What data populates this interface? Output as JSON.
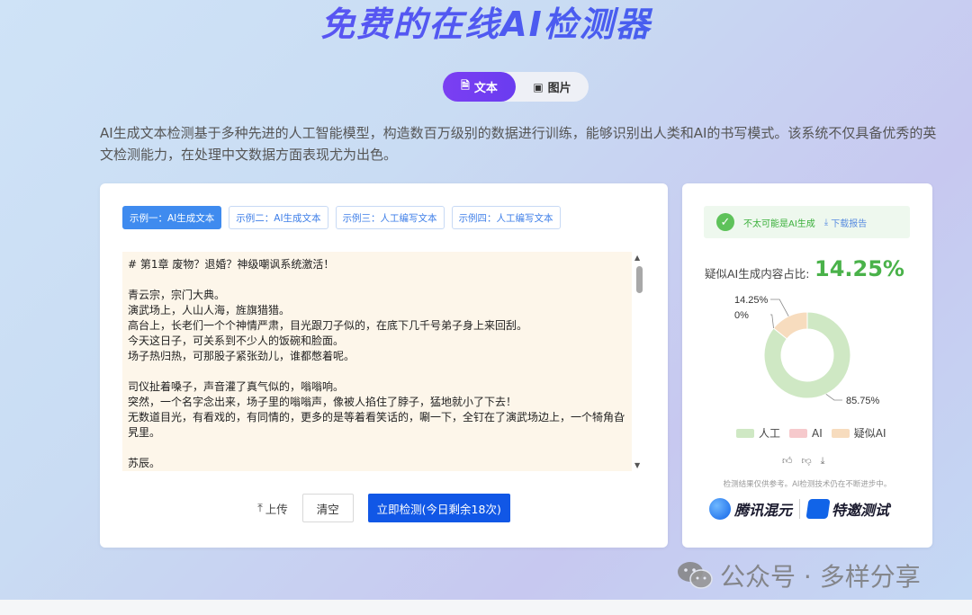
{
  "header": {
    "title": "免费的在线AI检测器"
  },
  "tabs": [
    {
      "label": "文本",
      "icon": "document-icon"
    },
    {
      "label": "图片",
      "icon": "image-icon"
    }
  ],
  "description": "AI生成文本检测基于多种先进的人工智能模型，构造数百万级别的数据进行训练，能够识别出人类和AI的书写模式。该系统不仅具备优秀的英文检测能力，在处理中文数据方面表现尤为出色。",
  "samples": [
    "示例一：AI生成文本",
    "示例二：AI生成文本",
    "示例三：人工编写文本",
    "示例四：人工编写文本"
  ],
  "editor": {
    "content": "# 第1章 废物？退婚？神级嘲讽系统激活！\n\n青云宗，宗门大典。\n演武场上，人山人海，旌旗猎猎。\n高台上，长老们一个个神情严肃，目光跟刀子似的，在底下几千号弟子身上来回刮。\n今天这日子，可关系到不少人的饭碗和脸面。\n场子热归热，可那股子紧张劲儿，谁都憋着呢。\n\n司仪扯着嗓子，声音灌了真气似的，嗡嗡响。\n突然，一个名字念出来，场子里的嗡嗡声，像被人掐住了脖子，猛地就小了下去！\n无数道目光，有看戏的，有同情的，更多的是等着看笑话的，唰一下，全钉在了演武场边上，一个犄角旮旯里。\n\n苏辰。\n就是他。"
  },
  "actions": {
    "upload_label": "上传",
    "clear_label": "清空",
    "detect_label": "立即检测(今日剩余18次)"
  },
  "result": {
    "status_text": "不太可能是AI生成",
    "download_label": "下载报告",
    "ratio_label": "疑似AI生成内容占比:",
    "ratio_value": "14.25%",
    "disclaimer": "检测结果仅供参考。AI检测技术仍在不断进步中。"
  },
  "chart_data": {
    "type": "pie",
    "categories": [
      "人工",
      "AI",
      "疑似AI"
    ],
    "values": [
      85.75,
      0,
      14.25
    ],
    "data_labels": [
      "85.75%",
      "0%",
      "14.25%"
    ],
    "colors": [
      "#cfe8c4",
      "#f6c9cc",
      "#f7dcbe"
    ],
    "legend_placement": "bottom"
  },
  "brands": {
    "hunyuan": "腾讯混元",
    "invite": "特邀测试"
  },
  "watermark": {
    "text": "公众号 · 多样分享"
  },
  "colors": {
    "accent": "#6a3cf0",
    "primary_button": "#1157e6",
    "success": "#4ab24a"
  }
}
